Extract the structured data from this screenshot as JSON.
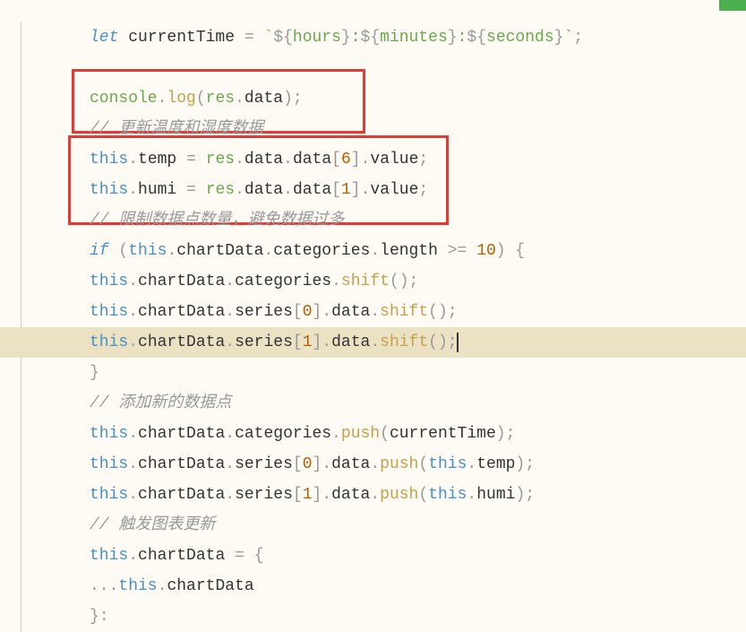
{
  "code": {
    "line1": {
      "let": "let",
      "sp1": " ",
      "var": "currentTime",
      "sp2": " ",
      "eq": "=",
      "sp3": " ",
      "tick1": "`",
      "dollar1": "${",
      "hours": "hours",
      "close1": "}",
      "colon1": ":",
      "dollar2": "${",
      "minutes": "minutes",
      "close2": "}",
      "colon2": ":",
      "dollar3": "${",
      "seconds": "seconds",
      "close3": "}",
      "tick2": "`",
      "semi": ";"
    },
    "line3": {
      "console": "console",
      "dot1": ".",
      "log": "log",
      "open": "(",
      "res": "res",
      "dot2": ".",
      "data": "data",
      "close": ")",
      "semi": ";"
    },
    "line4": {
      "comment": "// 更新温度和湿度数据"
    },
    "line5": {
      "this": "this",
      "dot1": ".",
      "temp": "temp",
      "sp1": " ",
      "eq": "=",
      "sp2": " ",
      "res": "res",
      "dot2": ".",
      "data1": "data",
      "dot3": ".",
      "data2": "data",
      "open": "[",
      "num": "6",
      "close": "]",
      "dot4": ".",
      "value": "value",
      "semi": ";"
    },
    "line6": {
      "this": "this",
      "dot1": ".",
      "humi": "humi",
      "sp1": " ",
      "eq": "=",
      "sp2": " ",
      "res": "res",
      "dot2": ".",
      "data1": "data",
      "dot3": ".",
      "data2": "data",
      "open": "[",
      "num": "1",
      "close": "]",
      "dot4": ".",
      "value": "value",
      "semi": ";"
    },
    "line7": {
      "comment": "// 限制数据点数量，避免数据过多"
    },
    "line8": {
      "if": "if",
      "sp1": " ",
      "open": "(",
      "this": "this",
      "dot1": ".",
      "chartData": "chartData",
      "dot2": ".",
      "categories": "categories",
      "dot3": ".",
      "length": "length",
      "sp2": " ",
      "gte": ">=",
      "sp3": " ",
      "num": "10",
      "close": ")",
      "sp4": " ",
      "brace": "{"
    },
    "line9": {
      "this": "this",
      "dot1": ".",
      "chartData": "chartData",
      "dot2": ".",
      "categories": "categories",
      "dot3": ".",
      "shift": "shift",
      "open": "(",
      "close": ")",
      "semi": ";"
    },
    "line10": {
      "this": "this",
      "dot1": ".",
      "chartData": "chartData",
      "dot2": ".",
      "series": "series",
      "open": "[",
      "num": "0",
      "close": "]",
      "dot3": ".",
      "data": "data",
      "dot4": ".",
      "shift": "shift",
      "open2": "(",
      "close2": ")",
      "semi": ";"
    },
    "line11": {
      "this": "this",
      "dot1": ".",
      "chartData": "chartData",
      "dot2": ".",
      "series": "series",
      "open": "[",
      "num": "1",
      "close": "]",
      "dot3": ".",
      "data": "data",
      "dot4": ".",
      "shift": "shift",
      "open2": "(",
      "close2": ")",
      "semi": ";"
    },
    "line12": {
      "brace": "}"
    },
    "line13": {
      "comment": "// 添加新的数据点"
    },
    "line14": {
      "this": "this",
      "dot1": ".",
      "chartData": "chartData",
      "dot2": ".",
      "categories": "categories",
      "dot3": ".",
      "push": "push",
      "open": "(",
      "currentTime": "currentTime",
      "close": ")",
      "semi": ";"
    },
    "line15": {
      "this": "this",
      "dot1": ".",
      "chartData": "chartData",
      "dot2": ".",
      "series": "series",
      "open": "[",
      "num": "0",
      "close": "]",
      "dot3": ".",
      "data": "data",
      "dot4": ".",
      "push": "push",
      "open2": "(",
      "this2": "this",
      "dot5": ".",
      "temp": "temp",
      "close2": ")",
      "semi": ";"
    },
    "line16": {
      "this": "this",
      "dot1": ".",
      "chartData": "chartData",
      "dot2": ".",
      "series": "series",
      "open": "[",
      "num": "1",
      "close": "]",
      "dot3": ".",
      "data": "data",
      "dot4": ".",
      "push": "push",
      "open2": "(",
      "this2": "this",
      "dot5": ".",
      "humi": "humi",
      "close2": ")",
      "semi": ";"
    },
    "line17": {
      "comment": "// 触发图表更新"
    },
    "line18": {
      "this": "this",
      "dot1": ".",
      "chartData": "chartData",
      "sp1": " ",
      "eq": "=",
      "sp2": " ",
      "brace": "{"
    },
    "line19": {
      "spread": "...",
      "this": "this",
      "dot1": ".",
      "chartData": "chartData"
    },
    "line20": {
      "brace": "}",
      "semi": ":"
    }
  }
}
